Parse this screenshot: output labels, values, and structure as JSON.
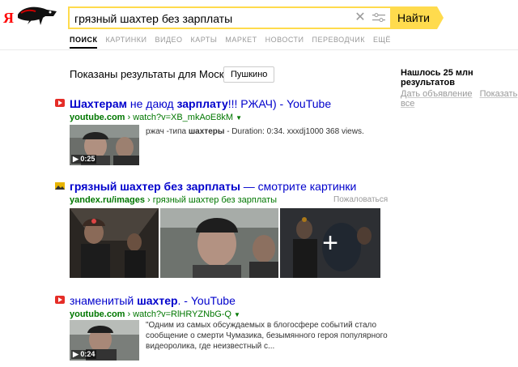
{
  "logo": {
    "letter": "Я"
  },
  "search": {
    "query": "грязный шахтер без зарплаты",
    "button": "Найти"
  },
  "tabs": [
    "ПОИСК",
    "КАРТИНКИ",
    "ВИДЕО",
    "КАРТЫ",
    "МАРКЕТ",
    "НОВОСТИ",
    "ПЕРЕВОДЧИК",
    "ЕЩЁ"
  ],
  "region": {
    "text": "Показаны результаты для Москвы",
    "button": "Пушкино"
  },
  "stats": {
    "found": "Нашлось 25 млн результатов",
    "ad": "Дать объявление",
    "show_all": "Показать все"
  },
  "results": [
    {
      "title_parts": [
        "Шахтерам",
        " не даюд ",
        "зарплату",
        "!!! РЖАЧ) - YouTube"
      ],
      "url_domain": "youtube.com",
      "url_path": " › watch?v=XB_mkAoE8kM",
      "snippet_pre": "ржач -типа ",
      "snippet_bold": "шахтеры",
      "snippet_post": " - Duration: 0:34. xxxdj1000 368 views.",
      "duration": "0:25"
    },
    {
      "title_parts": [
        "грязный шахтер без зарплаты",
        " — смотрите картинки"
      ],
      "url_domain": "yandex.ru/images",
      "url_path": " › грязный шахтер без зарплаты",
      "complain": "Пожаловаться"
    },
    {
      "title_parts": [
        "знаменитый ",
        "шахтер",
        ". - YouTube"
      ],
      "url_domain": "youtube.com",
      "url_path": " › watch?v=RlHRYZNbG-Q",
      "snippet": "\"Одним из самых обсуждаемых в блогосфере событий стало сообщение о смерти Чумазика, безымянного героя популярного видеоролика, где неизвестный с...",
      "duration": "0:24"
    }
  ],
  "colors": {
    "link": "#0000cc",
    "url": "#007700",
    "accent": "#ffdb4d",
    "youtube": "#e52d27"
  }
}
